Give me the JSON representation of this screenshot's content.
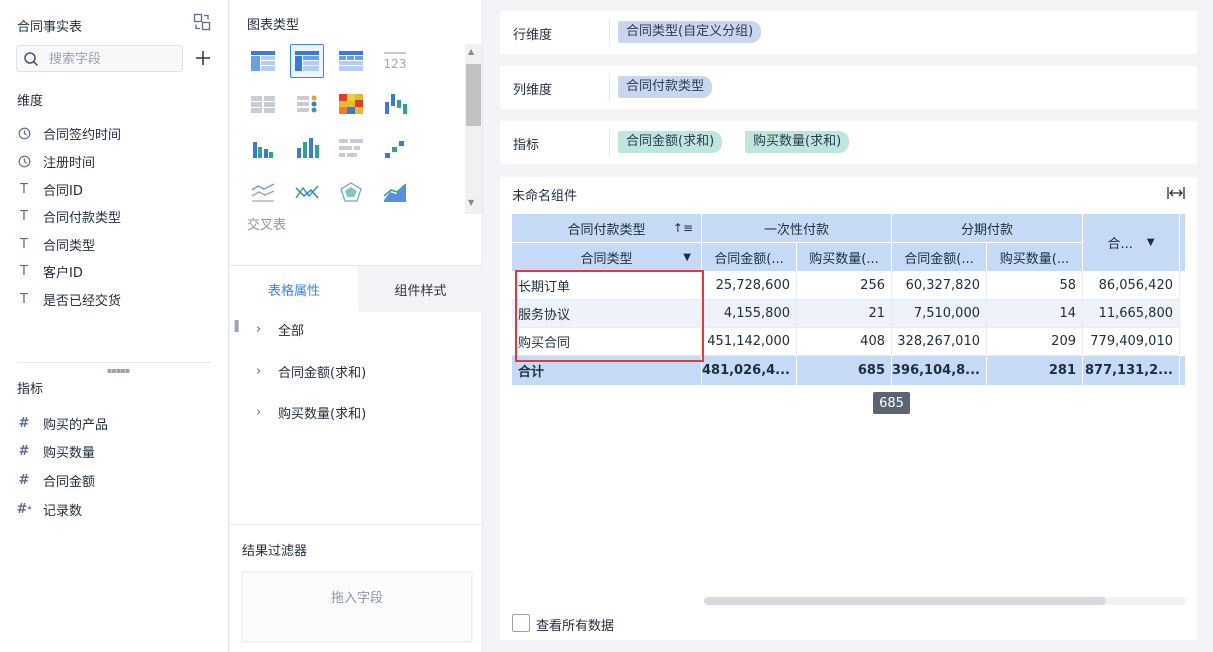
{
  "fields_panel": {
    "title": "合同事实表",
    "search_placeholder": "搜索字段",
    "dimensions_label": "维度",
    "dimensions": [
      {
        "label": "合同签约时间",
        "icon": "clock-icon"
      },
      {
        "label": "注册时间",
        "icon": "clock-icon"
      },
      {
        "label": "合同ID",
        "icon": "text-type-icon"
      },
      {
        "label": "合同付款类型",
        "icon": "text-type-icon"
      },
      {
        "label": "合同类型",
        "icon": "text-type-icon"
      },
      {
        "label": "客户ID",
        "icon": "text-type-icon"
      },
      {
        "label": "是否已经交货",
        "icon": "text-type-icon"
      }
    ],
    "measures_label": "指标",
    "measures": [
      {
        "label": "购买的产品",
        "icon": "number-type-icon"
      },
      {
        "label": "购买数量",
        "icon": "number-type-icon"
      },
      {
        "label": "合同金额",
        "icon": "number-type-icon"
      },
      {
        "label": "记录数",
        "icon": "record-count-icon"
      }
    ]
  },
  "chart_panel": {
    "title": "图表类型",
    "selected_type_label": "交叉表",
    "tabs": {
      "table_props": "表格属性",
      "component_style": "组件样式"
    },
    "properties": [
      "全部",
      "合同金额(求和)",
      "购买数量(求和)"
    ],
    "filter_title": "结果过滤器",
    "filter_placeholder": "拖入字段"
  },
  "shelves": {
    "row_label": "行维度",
    "row_pills": [
      "合同类型(自定义分组)"
    ],
    "col_label": "列维度",
    "col_pills": [
      "合同付款类型"
    ],
    "measure_label": "指标",
    "measure_pills": [
      "合同金额(求和)",
      "购买数量(求和)"
    ]
  },
  "component": {
    "title": "未命名组件",
    "table": {
      "corner_col_header": "合同付款类型",
      "corner_row_header": "合同类型",
      "groups": [
        "一次性付款",
        "分期付款",
        "合..."
      ],
      "sub_headers": [
        "合同金额(...",
        "购买数量(...",
        "合同金额(...",
        "购买数量(..."
      ],
      "rows": [
        {
          "name": "长期订单",
          "v1": "25,728,600",
          "v2": "256",
          "v3": "60,327,820",
          "v4": "58",
          "v5": "86,056,420"
        },
        {
          "name": "服务协议",
          "v1": "4,155,800",
          "v2": "21",
          "v3": "7,510,000",
          "v4": "14",
          "v5": "11,665,800"
        },
        {
          "name": "购买合同",
          "v1": "451,142,000",
          "v2": "408",
          "v3": "328,267,010",
          "v4": "209",
          "v5": "779,409,010"
        }
      ],
      "total": {
        "name": "合计",
        "v1": "481,026,4...",
        "v2": "685",
        "v3": "396,104,8...",
        "v4": "281",
        "v5": "877,131,2..."
      }
    },
    "tooltip": "685",
    "view_all_label": "查看所有数据"
  }
}
